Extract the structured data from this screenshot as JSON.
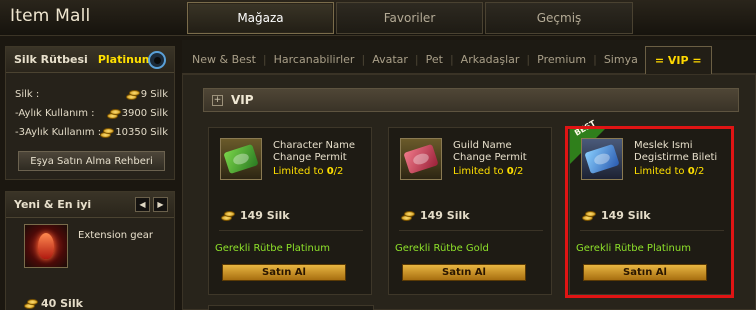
{
  "header": {
    "app_title": "Item Mall",
    "tabs": [
      {
        "label": "Mağaza",
        "active": true
      },
      {
        "label": "Favoriler",
        "active": false
      },
      {
        "label": "Geçmiş",
        "active": false
      }
    ]
  },
  "sidebar": {
    "rank_label": "Silk Rütbesi",
    "rank_value": "Platinum",
    "silk_rows": [
      {
        "label": "Silk :",
        "value": "9 Silk"
      },
      {
        "label": "-Aylık Kullanım :",
        "value": "3900 Silk"
      },
      {
        "label": "-3Aylık Kullanım :",
        "value": "10350 Silk"
      }
    ],
    "guide_button": "Eşya Satın Alma Rehberi",
    "new_best": {
      "title": "Yeni & En iyi",
      "prev_arrow": "◀",
      "next_arrow": "▶",
      "item_name": "Extension gear",
      "item_price": "40 Silk"
    }
  },
  "categories": [
    {
      "label": "New & Best",
      "active": false
    },
    {
      "label": "Harcanabilirler",
      "active": false
    },
    {
      "label": "Avatar",
      "active": false
    },
    {
      "label": "Pet",
      "active": false
    },
    {
      "label": "Arkadaşlar",
      "active": false
    },
    {
      "label": "Premium",
      "active": false
    },
    {
      "label": "Simya",
      "active": false
    },
    {
      "label": "= VIP =",
      "active": true
    }
  ],
  "section": {
    "expand_symbol": "+",
    "title": "VIP"
  },
  "items": [
    {
      "name": "Character Name Change Permit",
      "limit_prefix": "Limited to ",
      "limit_used": "0",
      "limit_total": "/2",
      "price": "149 Silk",
      "requirement": "Gerekli Rütbe Platinum",
      "buy_label": "Satın Al",
      "best": false,
      "icon_color": "#3aa83a"
    },
    {
      "name": "Guild Name Change Permit",
      "limit_prefix": "Limited to ",
      "limit_used": "0",
      "limit_total": "/2",
      "price": "149 Silk",
      "requirement": "Gerekli Rütbe Gold",
      "buy_label": "Satın Al",
      "best": false,
      "icon_color": "#d9455a"
    },
    {
      "name": "Meslek Ismi Degistirme Bileti",
      "limit_prefix": "Limited to ",
      "limit_used": "0",
      "limit_total": "/2",
      "price": "149 Silk",
      "requirement": "Gerekli Rütbe Platinum",
      "buy_label": "Satın Al",
      "best": true,
      "best_label": "BEST",
      "icon_color": "#3f8fd8"
    }
  ],
  "colors": {
    "accent_gold": "#ffe000",
    "requirement_green": "#8ee22a",
    "highlight_red": "#e01414",
    "buy_button": "#d8a030"
  }
}
